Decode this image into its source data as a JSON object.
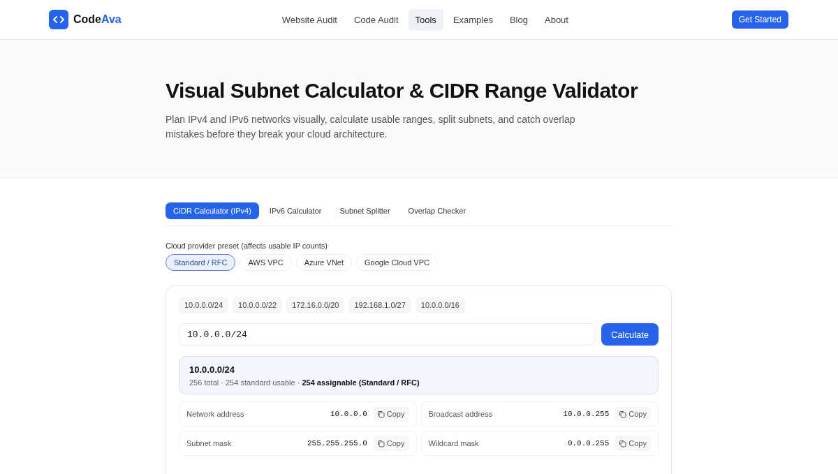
{
  "header": {
    "logo": {
      "primary": "Code",
      "accent": "Ava"
    },
    "nav": [
      {
        "label": "Website Audit",
        "selected": false
      },
      {
        "label": "Code Audit",
        "selected": false
      },
      {
        "label": "Tools",
        "selected": true
      },
      {
        "label": "Examples",
        "selected": false
      },
      {
        "label": "Blog",
        "selected": false
      },
      {
        "label": "About",
        "selected": false
      }
    ],
    "cta": "Get Started"
  },
  "hero": {
    "title": "Visual Subnet Calculator & CIDR Range Validator",
    "description": "Plan IPv4 and IPv6 networks visually, calculate usable ranges, split subnets, and catch overlap mistakes before they break your cloud architecture."
  },
  "tabs": [
    {
      "label": "CIDR Calculator (IPv4)",
      "selected": true
    },
    {
      "label": "IPv6 Calculator",
      "selected": false
    },
    {
      "label": "Subnet Splitter",
      "selected": false
    },
    {
      "label": "Overlap Checker",
      "selected": false
    }
  ],
  "preset": {
    "label": "Cloud provider preset (affects usable IP counts)",
    "options": [
      {
        "label": "Standard / RFC",
        "selected": true
      },
      {
        "label": "AWS VPC",
        "selected": false
      },
      {
        "label": "Azure VNet",
        "selected": false
      },
      {
        "label": "Google Cloud VPC",
        "selected": false
      }
    ]
  },
  "calculator": {
    "examples": [
      "10.0.0.0/24",
      "10.0.0.0/22",
      "172.16.0.0/20",
      "192.168.1.0/27",
      "10.0.0.0/16"
    ],
    "input": {
      "value": "10.0.0.0/24"
    },
    "button": "Calculate",
    "summary": {
      "title": "10.0.0.0/24",
      "details": "256 total · 254 standard usable · **254 assignable (Standard / RFC)**"
    },
    "results": [
      {
        "label": "Network address",
        "value": "10.0.0.0",
        "action": "Copy"
      },
      {
        "label": "Broadcast address",
        "value": "10.0.0.255",
        "action": "Copy"
      },
      {
        "label": "Subnet mask",
        "value": "255.255.255.0",
        "action": "Copy"
      },
      {
        "label": "Wildcard mask",
        "value": "0.0.0.255",
        "action": "Copy"
      }
    ]
  }
}
